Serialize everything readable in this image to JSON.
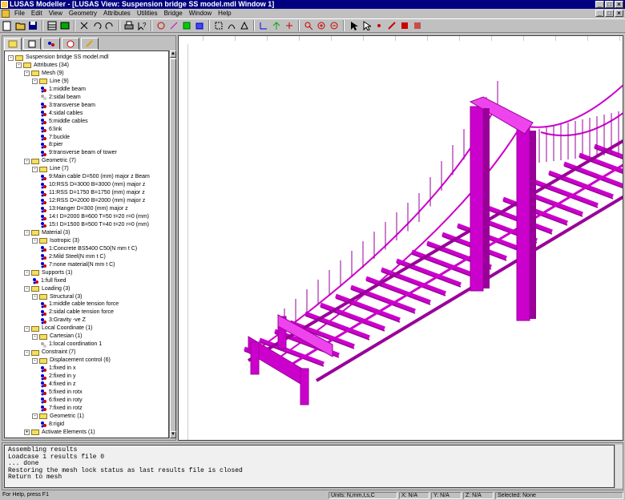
{
  "window": {
    "title": "LUSAS Modeller - [LUSAS View: Suspension bridge SS model.mdl Window 1]"
  },
  "menu": {
    "items": [
      "File",
      "Edit",
      "View",
      "Geometry",
      "Attributes",
      "Utilities",
      "Bridge",
      "Window",
      "Help"
    ]
  },
  "tree": {
    "rows": [
      {
        "text": "Suspension bridge SS model.mdl",
        "type": "folder",
        "expander": "-"
      },
      {
        "text": "Attributes (34)",
        "type": "folder",
        "expander": "-"
      },
      {
        "text": "Mesh (9)",
        "type": "folder",
        "expander": "-"
      },
      {
        "text": "Line (9)",
        "type": "folder",
        "expander": "-"
      },
      {
        "text": "1:middle beam",
        "type": "item"
      },
      {
        "text": "2:sidal beam",
        "type": "item-gray"
      },
      {
        "text": "3:transverse beam",
        "type": "item"
      },
      {
        "text": "4:sidal cables",
        "type": "item"
      },
      {
        "text": "5:middle cables",
        "type": "item"
      },
      {
        "text": "6:link",
        "type": "item"
      },
      {
        "text": "7:buckle",
        "type": "item"
      },
      {
        "text": "8:pier",
        "type": "item"
      },
      {
        "text": "9:transverse beam of tower",
        "type": "item"
      },
      {
        "text": "Geometric (7)",
        "type": "folder",
        "expander": "-"
      },
      {
        "text": "Line (7)",
        "type": "folder",
        "expander": "-"
      },
      {
        "text": "9:Main cable D=500 (mm) major z Beam",
        "type": "item"
      },
      {
        "text": "10:RSS D=3000 B=3000 (mm) major z",
        "type": "item"
      },
      {
        "text": "11:RSS D=1750 B=1750 (mm) major z",
        "type": "item"
      },
      {
        "text": "12:RSS D=2000 B=2000 (mm) major z",
        "type": "item"
      },
      {
        "text": "13:Hanger D=300 (mm) major z",
        "type": "item"
      },
      {
        "text": "14:I D=2000 B=600 T=50 t=20 r=0 (mm)",
        "type": "item"
      },
      {
        "text": "15:I D=1500 B=500 T=40 t=20 r=0 (mm)",
        "type": "item"
      },
      {
        "text": "Material (3)",
        "type": "folder",
        "expander": "-"
      },
      {
        "text": "Isotropic (3)",
        "type": "folder",
        "expander": "-"
      },
      {
        "text": "1:Concrete BS5400 C50(N mm t C)",
        "type": "item"
      },
      {
        "text": "2:Mild Steel(N mm t C)",
        "type": "item"
      },
      {
        "text": "7:none material(N mm t C)",
        "type": "item"
      },
      {
        "text": "Supports (1)",
        "type": "folder",
        "expander": "-"
      },
      {
        "text": "1:full fixed",
        "type": "item"
      },
      {
        "text": "Loading (3)",
        "type": "folder",
        "expander": "-"
      },
      {
        "text": "Structural (3)",
        "type": "folder",
        "expander": "-"
      },
      {
        "text": "1:middle cable tension force",
        "type": "item"
      },
      {
        "text": "2:sidal cable tension force",
        "type": "item"
      },
      {
        "text": "3:Gravity -ve Z",
        "type": "item"
      },
      {
        "text": "Local Coordinate (1)",
        "type": "folder",
        "expander": "-"
      },
      {
        "text": "Cartesian (1)",
        "type": "folder",
        "expander": "-"
      },
      {
        "text": "1:local coordination 1",
        "type": "item-gray"
      },
      {
        "text": "Constraint (7)",
        "type": "folder",
        "expander": "-"
      },
      {
        "text": "Displacement control (6)",
        "type": "folder",
        "expander": "-"
      },
      {
        "text": "1:fixed in x",
        "type": "item"
      },
      {
        "text": "2:fixed in y",
        "type": "item"
      },
      {
        "text": "4:fixed in z",
        "type": "item"
      },
      {
        "text": "5:fixed in rotx",
        "type": "item"
      },
      {
        "text": "6:fixed in roty",
        "type": "item"
      },
      {
        "text": "7:fixed in rotz",
        "type": "item"
      },
      {
        "text": "Geometric (1)",
        "type": "folder",
        "expander": "-"
      },
      {
        "text": "8:rigid",
        "type": "item"
      },
      {
        "text": "Activate Elements (1)",
        "type": "folder",
        "expander": "+"
      }
    ]
  },
  "console": {
    "text": "Assembling results\nLoadcase 1 results file 0\n... done\nRestoring the mesh lock status as last results file is closed\nReturn to mesh"
  },
  "statusbar": {
    "help": "For Help, press F1",
    "units": "Units: N,mm,t,s,C",
    "x": "X: N/A",
    "y": "Y: N/A",
    "z": "Z: N/A",
    "selected": "Selected: None"
  },
  "colors": {
    "model": "#cc00cc",
    "model_dark": "#990099",
    "model_light": "#ee44ee"
  }
}
